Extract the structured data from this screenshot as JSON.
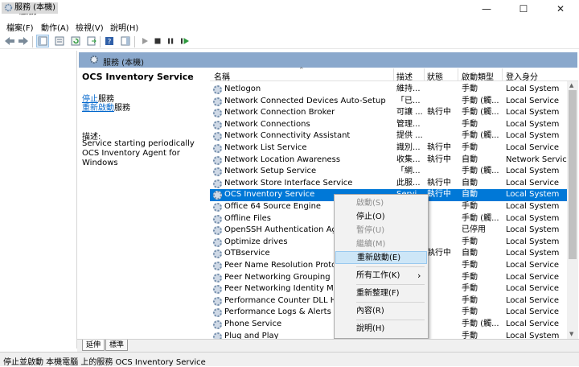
{
  "window": {
    "title": "服務",
    "minimize_glyph": "—",
    "maximize_glyph": "☐",
    "close_glyph": "✕"
  },
  "menu": [
    "檔案(F)",
    "動作(A)",
    "檢視(V)",
    "說明(H)"
  ],
  "tree": {
    "item": "服務 (本機)"
  },
  "panel_header": "服務 (本機)",
  "description": {
    "service_name": "OCS Inventory Service",
    "stop_link": "停止",
    "stop_suffix": "服務",
    "restart_link": "重新啟動",
    "restart_suffix": "服務",
    "desc_label": "描述:",
    "desc_text": "Service starting periodically OCS Inventory Agent for Windows"
  },
  "columns": {
    "name": "名稱",
    "desc": "描述",
    "status": "狀態",
    "startup": "啟動類型",
    "logon": "登入身分"
  },
  "rows": [
    {
      "name": "Netlogon",
      "desc": "維持...",
      "status": "",
      "startup": "手動",
      "logon": "Local System"
    },
    {
      "name": "Network Connected Devices Auto-Setup",
      "desc": "「已...",
      "status": "",
      "startup": "手動 (觸...",
      "logon": "Local Service"
    },
    {
      "name": "Network Connection Broker",
      "desc": "可讓 ...",
      "status": "執行中",
      "startup": "手動 (觸...",
      "logon": "Local System"
    },
    {
      "name": "Network Connections",
      "desc": "管理...",
      "status": "",
      "startup": "手動",
      "logon": "Local System"
    },
    {
      "name": "Network Connectivity Assistant",
      "desc": "提供 ...",
      "status": "",
      "startup": "手動 (觸...",
      "logon": "Local System"
    },
    {
      "name": "Network List Service",
      "desc": "識別...",
      "status": "執行中",
      "startup": "手動",
      "logon": "Local Service"
    },
    {
      "name": "Network Location Awareness",
      "desc": "收集...",
      "status": "執行中",
      "startup": "自動",
      "logon": "Network Service"
    },
    {
      "name": "Network Setup Service",
      "desc": "「網...",
      "status": "",
      "startup": "手動 (觸...",
      "logon": "Local System"
    },
    {
      "name": "Network Store Interface Service",
      "desc": "此服...",
      "status": "執行中",
      "startup": "自動",
      "logon": "Local Service"
    },
    {
      "name": "OCS Inventory Service",
      "desc": "Servi...",
      "status": "執行中",
      "startup": "自動",
      "logon": "Local System"
    },
    {
      "name": "Office 64 Source Engine",
      "desc": "",
      "status": "",
      "startup": "手動",
      "logon": "Local System"
    },
    {
      "name": "Offline Files",
      "desc": "",
      "status": "",
      "startup": "手動 (觸...",
      "logon": "Local System"
    },
    {
      "name": "OpenSSH Authentication Agent",
      "desc": "",
      "status": "",
      "startup": "已停用",
      "logon": "Local System"
    },
    {
      "name": "Optimize drives",
      "desc": "",
      "status": "",
      "startup": "手動",
      "logon": "Local System"
    },
    {
      "name": "OTBservice",
      "desc": "",
      "status": "執行中",
      "startup": "自動",
      "logon": "Local System"
    },
    {
      "name": "Peer Name Resolution Protocol",
      "desc": "",
      "status": "",
      "startup": "手動",
      "logon": "Local Service"
    },
    {
      "name": "Peer Networking Grouping",
      "desc": "",
      "status": "",
      "startup": "手動",
      "logon": "Local Service"
    },
    {
      "name": "Peer Networking Identity Manager",
      "desc": "",
      "status": "",
      "startup": "手動",
      "logon": "Local Service"
    },
    {
      "name": "Performance Counter DLL Host",
      "desc": "",
      "status": "",
      "startup": "手動",
      "logon": "Local Service"
    },
    {
      "name": "Performance Logs & Alerts",
      "desc": "",
      "status": "",
      "startup": "手動",
      "logon": "Local Service"
    },
    {
      "name": "Phone Service",
      "desc": "",
      "status": "",
      "startup": "手動 (觸...",
      "logon": "Local Service"
    },
    {
      "name": "Plug and Play",
      "desc": "",
      "status": "",
      "startup": "手動",
      "logon": "Local System"
    }
  ],
  "context_menu": {
    "start": "啟動(S)",
    "stop": "停止(O)",
    "pause": "暫停(U)",
    "resume": "繼續(M)",
    "restart": "重新啟動(E)",
    "all_tasks": "所有工作(K)",
    "all_tasks_arrow": "›",
    "refresh": "重新整理(F)",
    "properties": "內容(R)",
    "help": "說明(H)"
  },
  "tabs": [
    "延伸",
    "標準"
  ],
  "status_bar": "停止並啟動 本機電腦 上的服務 OCS Inventory Service",
  "colors": {
    "selection": "#0078d7",
    "panel_header": "#8aa8cc",
    "context_hover": "#cde6f7"
  }
}
